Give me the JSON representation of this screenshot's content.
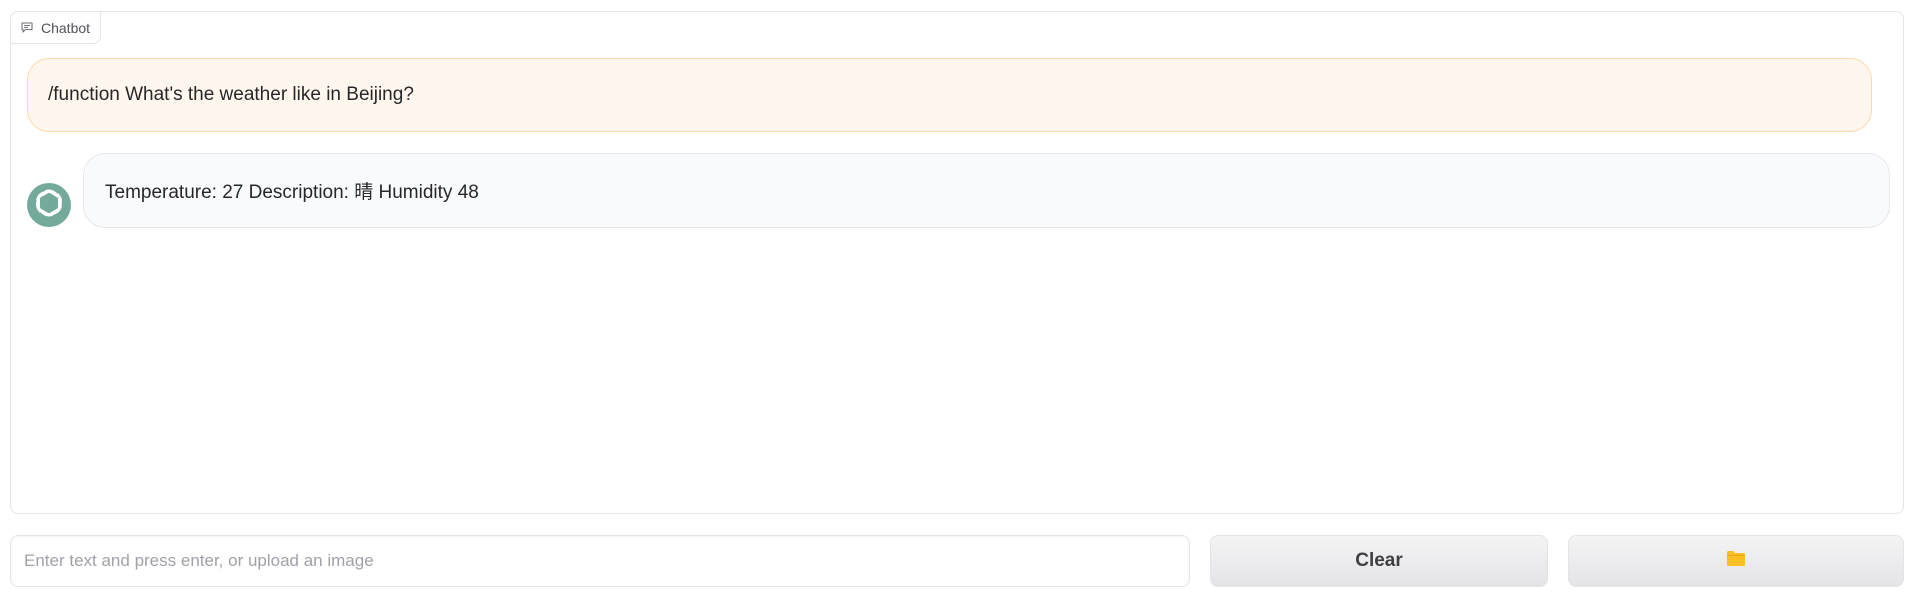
{
  "panel": {
    "label": "Chatbot",
    "label_icon": "chat-icon"
  },
  "messages": [
    {
      "role": "user",
      "text": "/function What's the weather like in Beijing?"
    },
    {
      "role": "bot",
      "avatar_icon": "openai-logo-icon",
      "text": "Temperature: 27 Description: 晴 Humidity 48"
    }
  ],
  "input": {
    "value": "",
    "placeholder": "Enter text and press enter, or upload an image"
  },
  "buttons": {
    "clear_label": "Clear",
    "upload_icon": "folder-icon"
  },
  "colors": {
    "user_bubble_bg": "#fff7ed",
    "user_bubble_border": "#fed7aa",
    "bot_bubble_bg": "#f9fafb",
    "avatar_bg": "#74aa9c",
    "folder_icon": "#fbbf24"
  }
}
